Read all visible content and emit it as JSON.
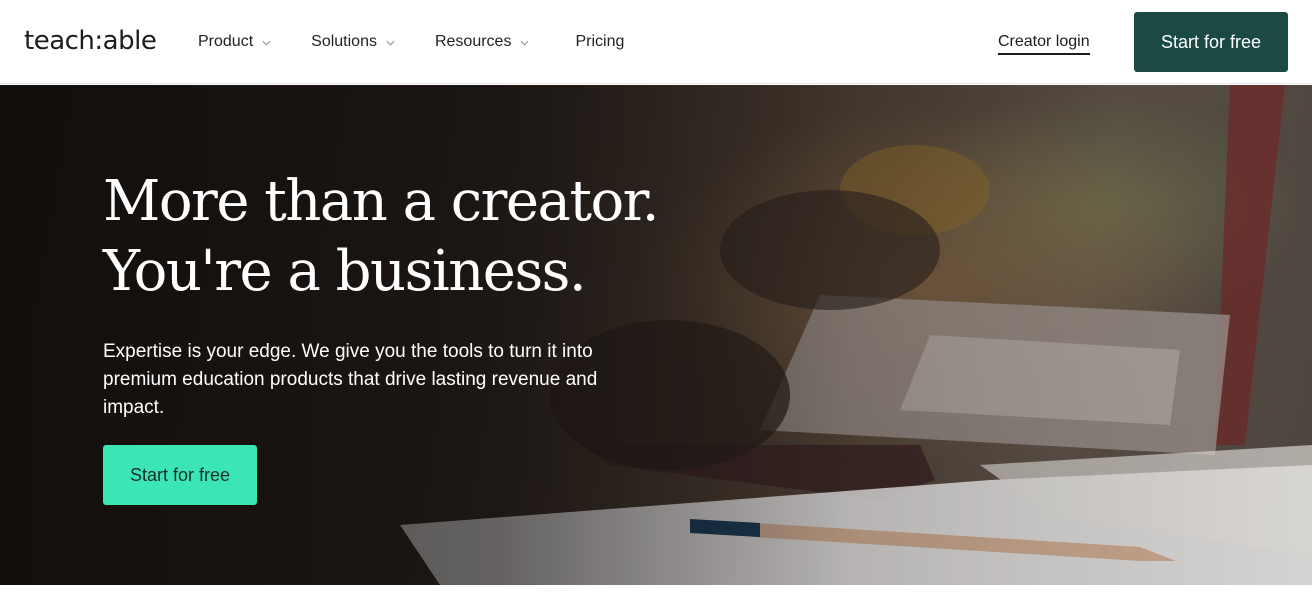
{
  "header": {
    "logo_text": "teach:able",
    "nav": {
      "product": "Product",
      "solutions": "Solutions",
      "resources": "Resources",
      "pricing": "Pricing"
    },
    "login_label": "Creator login",
    "cta_label": "Start for free"
  },
  "hero": {
    "title_line1": "More than a creator.",
    "title_line2": "You're a business.",
    "subtitle": "Expertise is your edge. We give you the tools to turn it into premium education products that drive lasting revenue and impact.",
    "cta_label": "Start for free"
  },
  "colors": {
    "brand_dark": "#1b4a45",
    "accent_mint": "#3ce6b4"
  },
  "icons": {
    "nav_dropdown": "chevron-down-icon"
  }
}
